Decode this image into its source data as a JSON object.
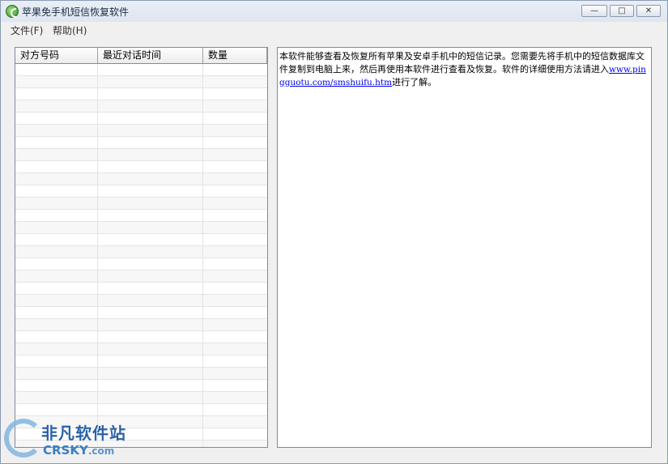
{
  "window": {
    "title": "苹果免手机短信恢复软件",
    "minimize_glyph": "—",
    "maximize_glyph": "□",
    "close_glyph": "✕"
  },
  "menu": {
    "file": "文件(F)",
    "help": "帮助(H)"
  },
  "conversation_list": {
    "columns": [
      "对方号码",
      "最近对话时间",
      "数量"
    ],
    "row_count_visible": 32,
    "rows": []
  },
  "info_text": {
    "before_link": "本软件能够查看及恢复所有苹果及安卓手机中的短信记录。您需要先将手机中的短信数据库文件复制到电脑上来，然后再使用本软件进行查看及恢复。软件的详细使用方法请进入",
    "link": "www.pingguotu.com/smshuifu.htm",
    "after_link": "进行了解。"
  },
  "watermark": {
    "cn": "非凡软件站",
    "en": "CRSKY",
    "en_suffix": ".com"
  },
  "colors": {
    "link": "#0000ee",
    "row_alt": "#f7f7f7",
    "grid": "#e4e4e4"
  }
}
